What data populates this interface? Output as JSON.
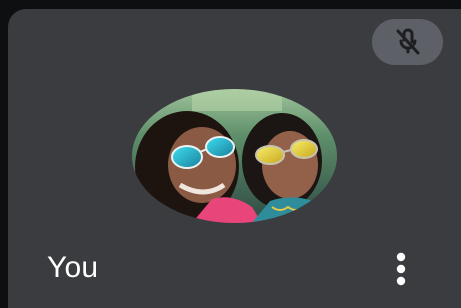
{
  "participant": {
    "name": "You"
  },
  "icons": {
    "mic": "mic-off-icon",
    "more": "more-vertical-icon"
  },
  "colors": {
    "tile_background": "#3a3c40",
    "mute_button": "#5d6167"
  }
}
